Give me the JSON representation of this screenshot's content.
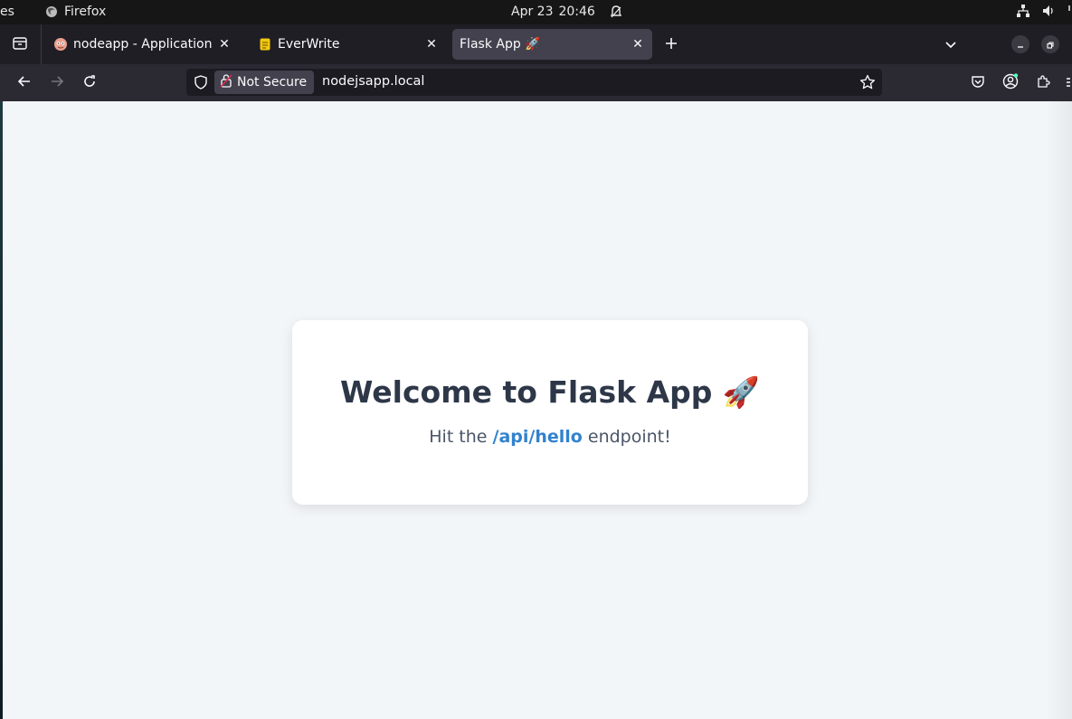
{
  "topbar": {
    "activities": "es",
    "app_name": "Firefox",
    "date": "Apr 23",
    "time": "20:46"
  },
  "tabs": [
    {
      "title": "nodeapp - Application De",
      "icon": "nodeapp-favicon",
      "active": false
    },
    {
      "title": "EverWrite",
      "icon": "note-favicon",
      "active": false
    },
    {
      "title": "Flask App 🚀",
      "icon": "none",
      "active": true
    }
  ],
  "navbar": {
    "security_label": "Not Secure",
    "url": "nodejsapp.local"
  },
  "page": {
    "heading": "Welcome to Flask App 🚀",
    "text_before": "Hit the ",
    "endpoint": "/api/hello",
    "text_after": " endpoint!"
  },
  "colors": {
    "page_bg": "#f3f6f9",
    "heading": "#2d3748",
    "endpoint": "#3182ce",
    "toolbar": "#2b2a33",
    "tabstrip": "#1f1e25"
  }
}
